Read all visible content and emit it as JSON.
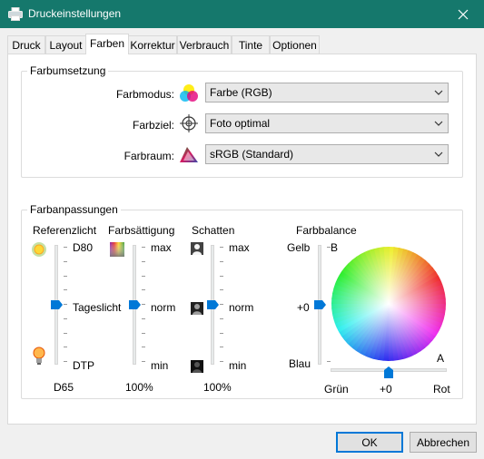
{
  "window": {
    "title": "Druckeinstellungen"
  },
  "tabs": [
    {
      "label": "Druck",
      "active": false
    },
    {
      "label": "Layout",
      "active": false
    },
    {
      "label": "Farben",
      "active": true
    },
    {
      "label": "Korrektur",
      "active": false
    },
    {
      "label": "Verbrauch",
      "active": false
    },
    {
      "label": "Tinte",
      "active": false
    },
    {
      "label": "Optionen",
      "active": false
    }
  ],
  "farbumsetzung": {
    "title": "Farbumsetzung",
    "farbmodus": {
      "label": "Farbmodus:",
      "value": "Farbe (RGB)",
      "icon": "cmy-circles-icon"
    },
    "farbziel": {
      "label": "Farbziel:",
      "value": "Foto optimal",
      "icon": "crosshair-target-icon"
    },
    "farbraum": {
      "label": "Farbraum:",
      "value": "sRGB (Standard)",
      "icon": "color-gamut-triangle-icon"
    }
  },
  "farbanpassungen": {
    "title": "Farbanpassungen",
    "referenzlicht": {
      "heading": "Referenzlicht",
      "top": "D80",
      "middle": "Tageslicht",
      "bottom": "DTP",
      "value": "D65",
      "top_icon": "sun-icon",
      "bottom_icon": "light-bulb-icon",
      "position": 0.5
    },
    "farbsaettigung": {
      "heading": "Farbsättigung",
      "top": "max",
      "middle": "norm",
      "bottom": "min",
      "value": "100%",
      "icon": "saturation-swatch-icon",
      "position": 0.5
    },
    "schatten": {
      "heading": "Schatten",
      "top": "max",
      "middle": "norm",
      "bottom": "min",
      "value": "100%",
      "top_icon": "portrait-light-icon",
      "middle_icon": "portrait-medium-icon",
      "bottom_icon": "portrait-dark-icon",
      "position": 0.5
    },
    "farbbalance": {
      "heading": "Farbbalance",
      "vertical": {
        "top": "Gelb",
        "bottom": "Blau",
        "value": "+0",
        "axis_top": "B",
        "position": 0.5
      },
      "horizontal": {
        "left": "Grün",
        "right": "Rot",
        "value": "+0",
        "axis_right": "A",
        "position": 0.5
      },
      "wheel_icon": "color-wheel-icon"
    }
  },
  "buttons": {
    "ok": "OK",
    "cancel": "Abbrechen"
  },
  "colors": {
    "titlebar": "#15786c",
    "thumb": "#0078d7",
    "default_border": "#0078d7"
  }
}
